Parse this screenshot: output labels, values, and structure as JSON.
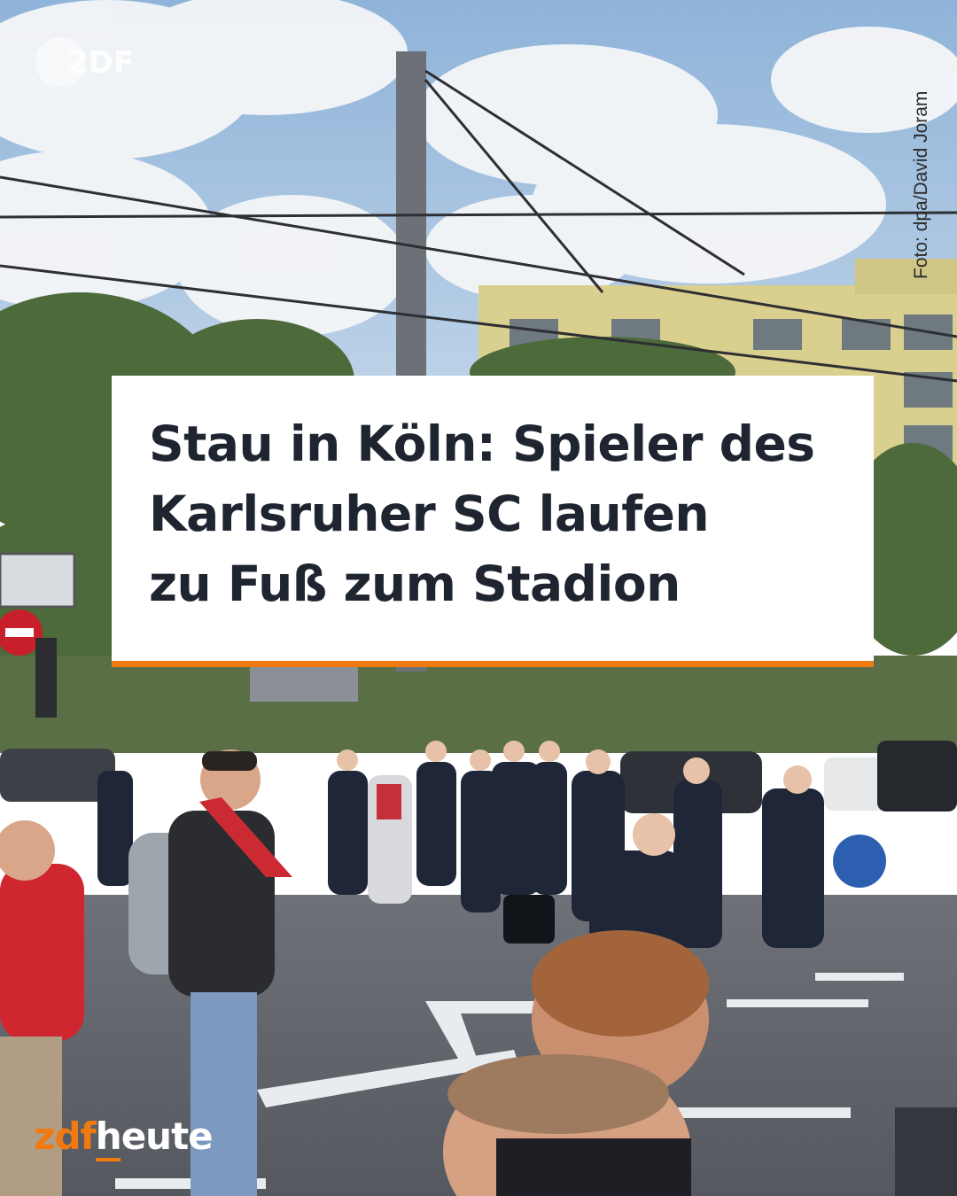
{
  "photo": {
    "description_icon": "street-photo"
  },
  "top_logo": {
    "text": "2DF",
    "icon": "zdf-logo-icon"
  },
  "credit": "Foto: dpa/David Joram",
  "headline": {
    "line1": "Stau in Köln: Spieler des",
    "line2": "Karlsruher SC laufen",
    "line3": "zu Fuß zum Stadion"
  },
  "brand": {
    "part1": "zdf",
    "part2": "heute"
  },
  "colors": {
    "accent": "#f07a10",
    "headline_text": "#1f2530",
    "box": "#ffffff"
  }
}
